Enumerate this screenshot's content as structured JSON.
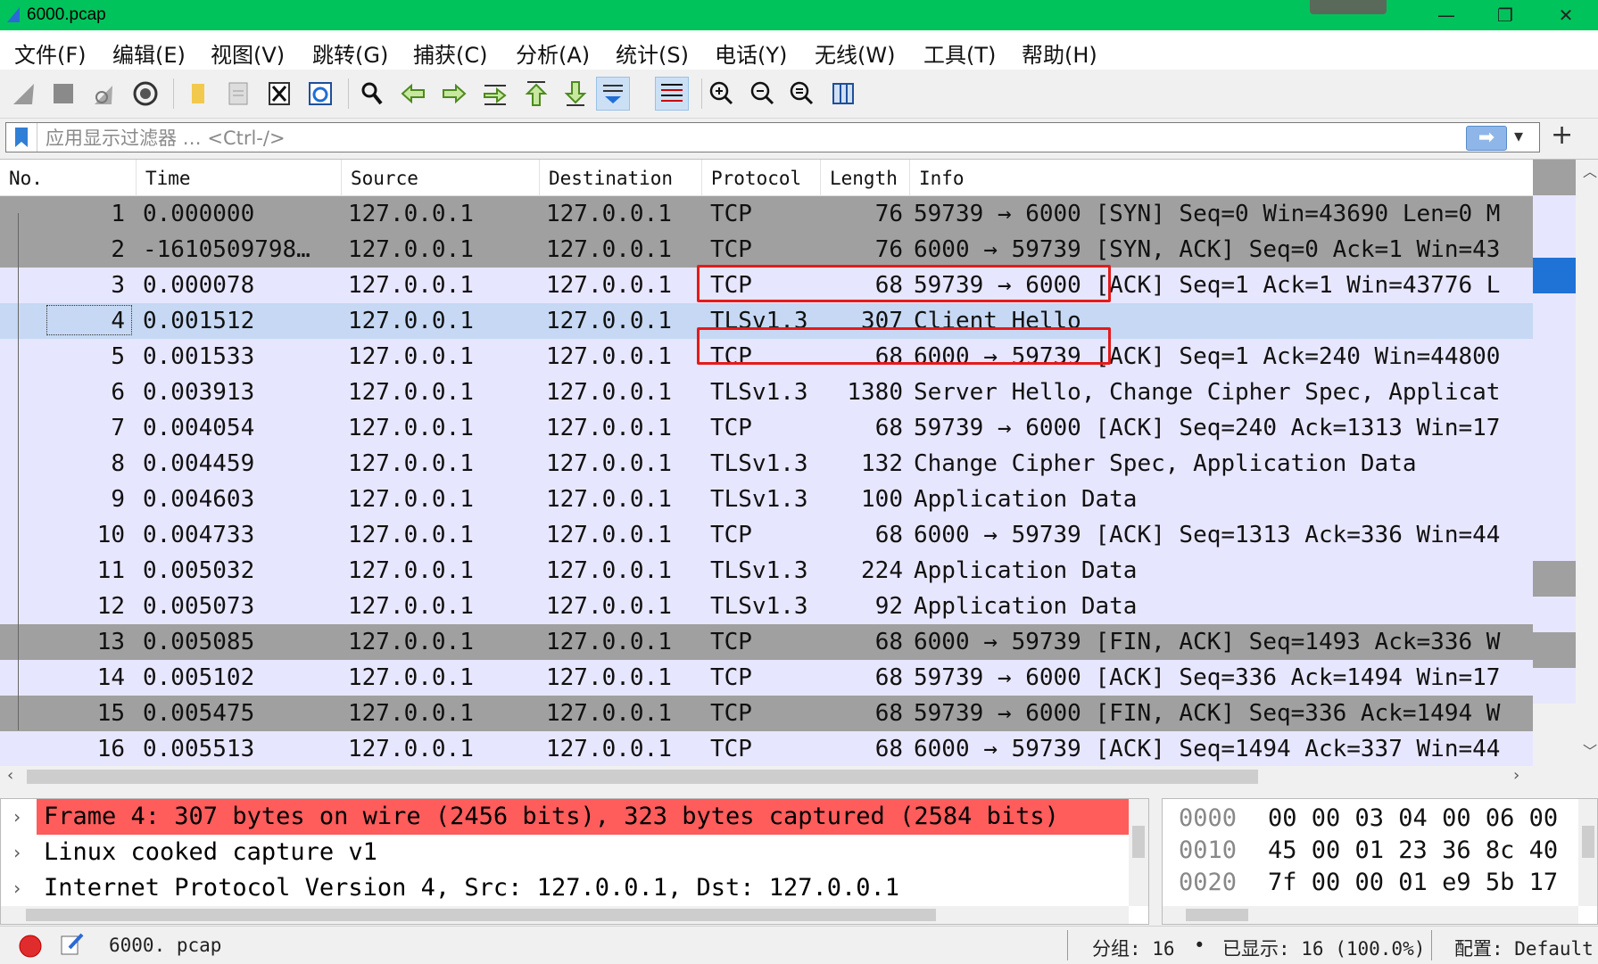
{
  "window": {
    "title": "6000.pcap",
    "controls": [
      "—",
      "❐",
      "✕"
    ]
  },
  "menu": [
    "文件(F)",
    "编辑(E)",
    "视图(V)",
    "跳转(G)",
    "捕获(C)",
    "分析(A)",
    "统计(S)",
    "电话(Y)",
    "无线(W)",
    "工具(T)",
    "帮助(H)"
  ],
  "toolbar": {
    "icons": [
      "shark-fin-start-icon",
      "stop-square-icon",
      "restart-shark-icon",
      "capture-options-gear-icon",
      "open-folder-icon",
      "save-file-icon",
      "close-file-icon",
      "reload-icon",
      "find-magnifier-icon",
      "go-back-arrow-icon",
      "go-forward-arrow-icon",
      "go-to-packet-icon",
      "go-first-arrow-icon",
      "go-last-arrow-icon",
      "autoscroll-icon",
      "colorize-lines-icon",
      "zoom-in-icon",
      "zoom-out-icon",
      "zoom-normal-icon",
      "resize-columns-icon"
    ]
  },
  "filter": {
    "placeholder": "应用显示过滤器 … <Ctrl-/>",
    "apply_arrow": "➡",
    "dropdown": "▾",
    "add": "+"
  },
  "columns": {
    "no": "No.",
    "time": "Time",
    "source": "Source",
    "destination": "Destination",
    "protocol": "Protocol",
    "length": "Length",
    "info": "Info"
  },
  "packets": [
    {
      "no": "1",
      "time": "0.000000",
      "src": "127.0.0.1",
      "dst": "127.0.0.1",
      "proto": "TCP",
      "len": "76",
      "info": "59739 → 6000 [SYN] Seq=0 Win=43690 Len=0 M",
      "style": "dark"
    },
    {
      "no": "2",
      "time": "-1610509798…",
      "src": "127.0.0.1",
      "dst": "127.0.0.1",
      "proto": "TCP",
      "len": "76",
      "info": "6000 → 59739 [SYN, ACK] Seq=0 Ack=1 Win=43",
      "style": "dark"
    },
    {
      "no": "3",
      "time": "0.000078",
      "src": "127.0.0.1",
      "dst": "127.0.0.1",
      "proto": "TCP",
      "len": "68",
      "info": "59739 → 6000 [ACK] Seq=1 Ack=1 Win=43776 L",
      "style": "light"
    },
    {
      "no": "4",
      "time": "0.001512",
      "src": "127.0.0.1",
      "dst": "127.0.0.1",
      "proto": "TLSv1.3",
      "len": "307",
      "info": "Client Hello",
      "style": "selected"
    },
    {
      "no": "5",
      "time": "0.001533",
      "src": "127.0.0.1",
      "dst": "127.0.0.1",
      "proto": "TCP",
      "len": "68",
      "info": "6000 → 59739 [ACK] Seq=1 Ack=240 Win=44800",
      "style": "light"
    },
    {
      "no": "6",
      "time": "0.003913",
      "src": "127.0.0.1",
      "dst": "127.0.0.1",
      "proto": "TLSv1.3",
      "len": "1380",
      "info": "Server Hello, Change Cipher Spec, Applicat",
      "style": "light"
    },
    {
      "no": "7",
      "time": "0.004054",
      "src": "127.0.0.1",
      "dst": "127.0.0.1",
      "proto": "TCP",
      "len": "68",
      "info": "59739 → 6000 [ACK] Seq=240 Ack=1313 Win=17",
      "style": "light"
    },
    {
      "no": "8",
      "time": "0.004459",
      "src": "127.0.0.1",
      "dst": "127.0.0.1",
      "proto": "TLSv1.3",
      "len": "132",
      "info": "Change Cipher Spec, Application Data",
      "style": "light"
    },
    {
      "no": "9",
      "time": "0.004603",
      "src": "127.0.0.1",
      "dst": "127.0.0.1",
      "proto": "TLSv1.3",
      "len": "100",
      "info": "Application Data",
      "style": "light"
    },
    {
      "no": "10",
      "time": "0.004733",
      "src": "127.0.0.1",
      "dst": "127.0.0.1",
      "proto": "TCP",
      "len": "68",
      "info": "6000 → 59739 [ACK] Seq=1313 Ack=336 Win=44",
      "style": "light"
    },
    {
      "no": "11",
      "time": "0.005032",
      "src": "127.0.0.1",
      "dst": "127.0.0.1",
      "proto": "TLSv1.3",
      "len": "224",
      "info": "Application Data",
      "style": "light"
    },
    {
      "no": "12",
      "time": "0.005073",
      "src": "127.0.0.1",
      "dst": "127.0.0.1",
      "proto": "TLSv1.3",
      "len": "92",
      "info": "Application Data",
      "style": "light"
    },
    {
      "no": "13",
      "time": "0.005085",
      "src": "127.0.0.1",
      "dst": "127.0.0.1",
      "proto": "TCP",
      "len": "68",
      "info": "6000 → 59739 [FIN, ACK] Seq=1493 Ack=336 W",
      "style": "dark"
    },
    {
      "no": "14",
      "time": "0.005102",
      "src": "127.0.0.1",
      "dst": "127.0.0.1",
      "proto": "TCP",
      "len": "68",
      "info": "59739 → 6000 [ACK] Seq=336 Ack=1494 Win=17",
      "style": "light"
    },
    {
      "no": "15",
      "time": "0.005475",
      "src": "127.0.0.1",
      "dst": "127.0.0.1",
      "proto": "TCP",
      "len": "68",
      "info": "59739 → 6000 [FIN, ACK] Seq=336 Ack=1494 W",
      "style": "dark"
    },
    {
      "no": "16",
      "time": "0.005513",
      "src": "127.0.0.1",
      "dst": "127.0.0.1",
      "proto": "TCP",
      "len": "68",
      "info": "6000 → 59739 [ACK] Seq=1494 Ack=337 Win=44",
      "style": "light"
    }
  ],
  "row_colors": {
    "dark": "#a0a0a0",
    "light": "#e7e6ff",
    "selected": "#c6d8f3",
    "highlight_box": "#e41b1b"
  },
  "details": [
    {
      "arrow": "›",
      "text": "Frame 4: 307 bytes on wire (2456 bits), 323 bytes captured (2584 bits)",
      "highlight": true
    },
    {
      "arrow": "›",
      "text": "Linux cooked capture v1",
      "highlight": false
    },
    {
      "arrow": "›",
      "text": "Internet Protocol Version 4, Src: 127.0.0.1, Dst: 127.0.0.1",
      "highlight": false
    }
  ],
  "detail_highlight_color": "#ff5c5c",
  "bytes": [
    {
      "offset": "0000",
      "hex": "00 00 03 04 00 06 00"
    },
    {
      "offset": "0010",
      "hex": "45 00 01 23 36 8c 40"
    },
    {
      "offset": "0020",
      "hex": "7f 00 00 01 e9 5b 17"
    }
  ],
  "status": {
    "file": "6000. pcap",
    "packets": "分组: 16",
    "dot": "•",
    "displayed": "已显示: 16 (100.0%)",
    "profile": "配置: Default"
  }
}
